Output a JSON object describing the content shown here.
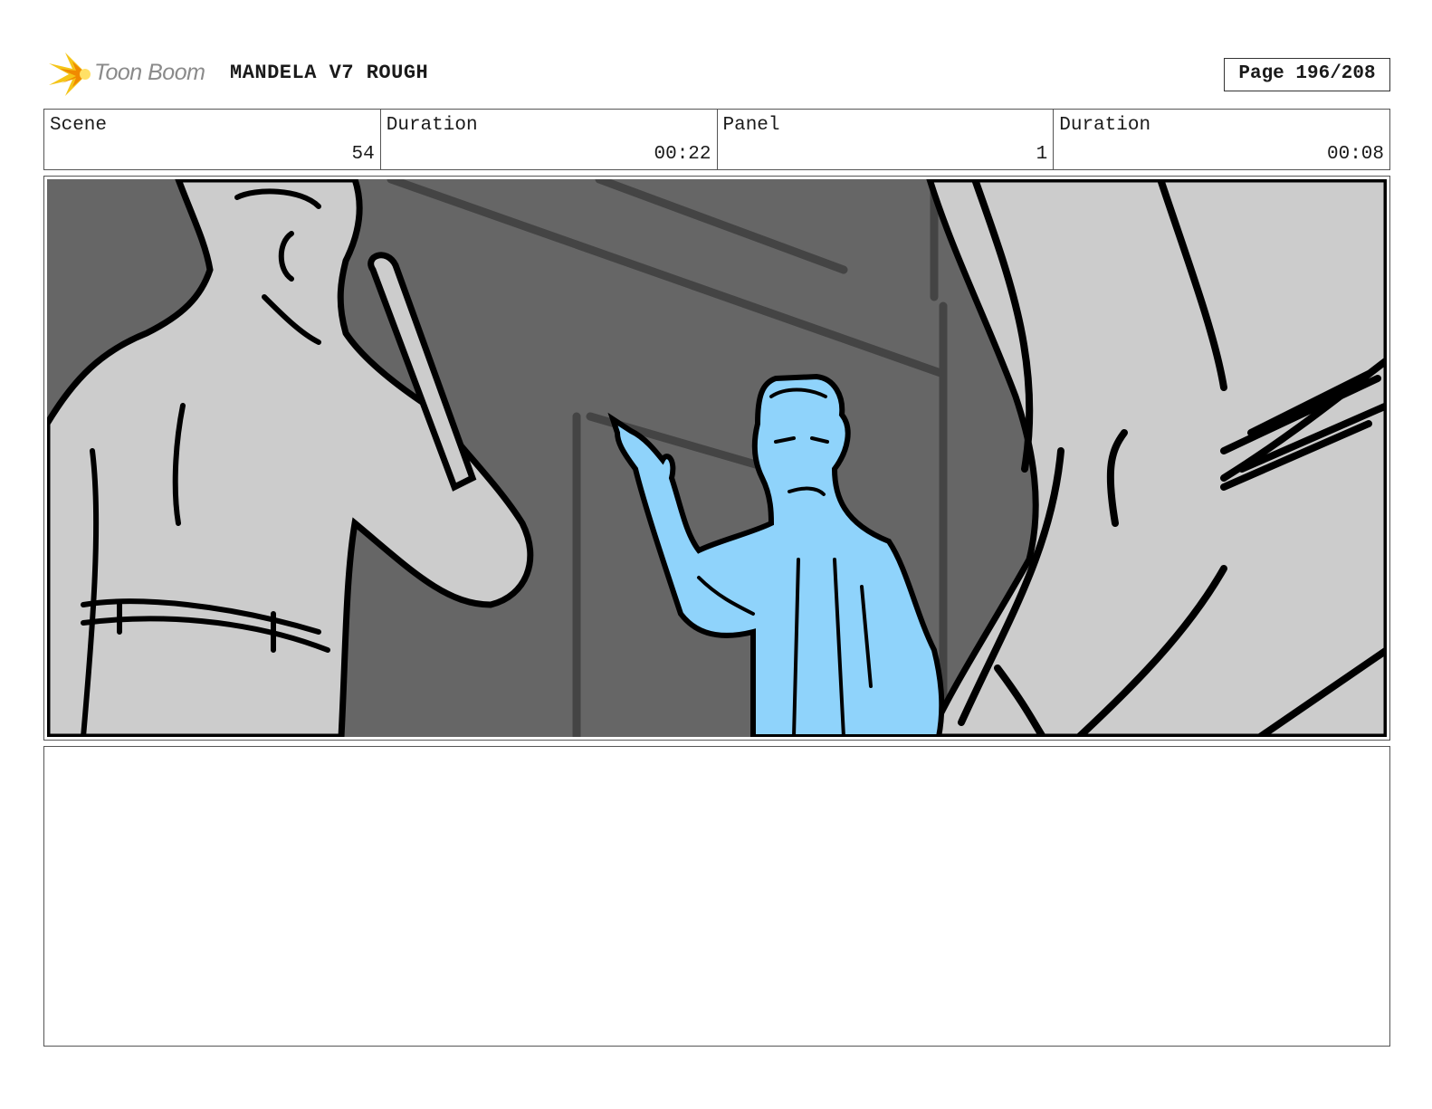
{
  "header": {
    "logo_text": "Toon Boom",
    "project_title": "MANDELA V7 ROUGH",
    "page_label": "Page 196/208"
  },
  "info": {
    "scene_label": "Scene",
    "scene_value": "54",
    "scene_duration_label": "Duration",
    "scene_duration_value": "00:22",
    "panel_label": "Panel",
    "panel_value": "1",
    "panel_duration_label": "Duration",
    "panel_duration_value": "00:08"
  },
  "colors": {
    "background_wall": "#666666",
    "foreground_figures": "#cccccc",
    "highlight_character": "#8fd3fb",
    "ink": "#000000",
    "logo_accent": "#f5c518"
  },
  "notes": {
    "text": ""
  }
}
